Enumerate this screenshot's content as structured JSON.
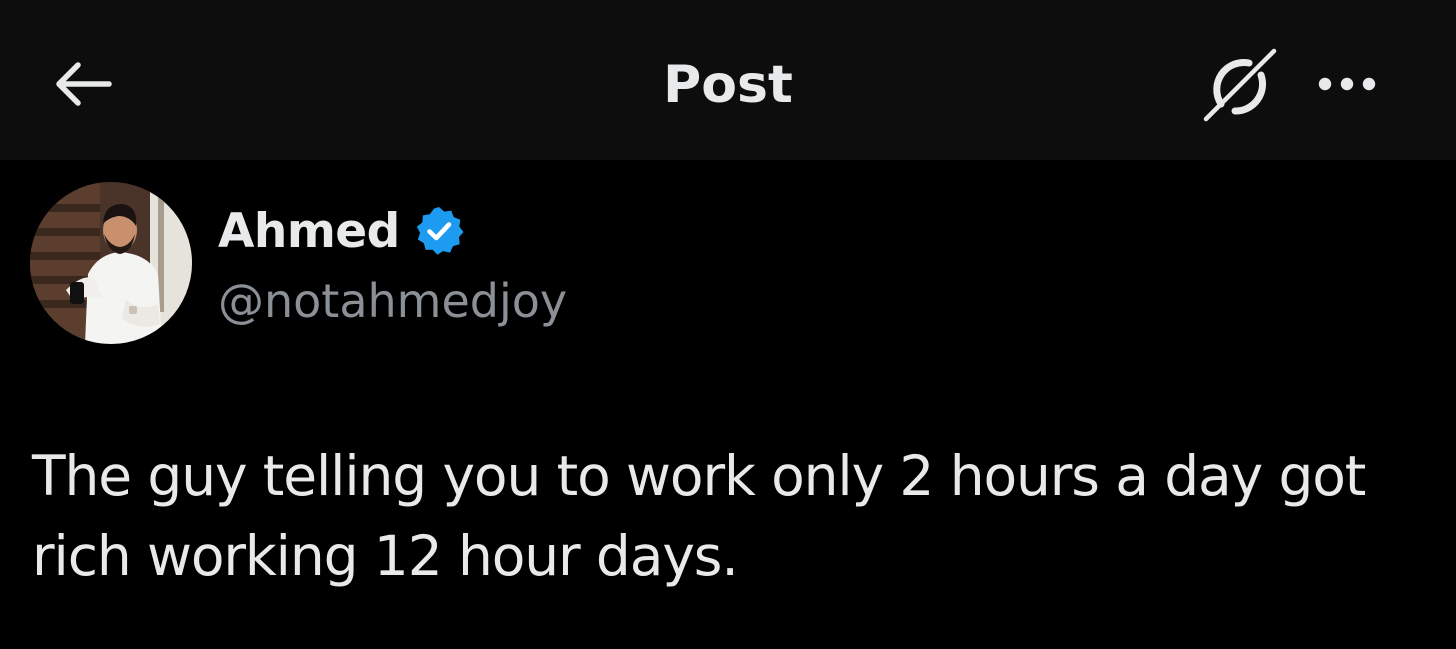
{
  "header": {
    "title": "Post",
    "back_icon": "arrow-left-icon",
    "grok_icon": "grok-icon",
    "more_icon": "more-horizontal-icon"
  },
  "author": {
    "display_name": "Ahmed",
    "handle": "@notahmedjoy",
    "verified": true,
    "verified_color": "#1d9bf0"
  },
  "post": {
    "text": "The guy telling you to work only 2 hours a day got rich working 12 hour days."
  },
  "colors": {
    "background": "#000000",
    "header_background": "#0d0d0d",
    "primary_text": "#e7e9ea",
    "secondary_text": "#8b9096"
  }
}
